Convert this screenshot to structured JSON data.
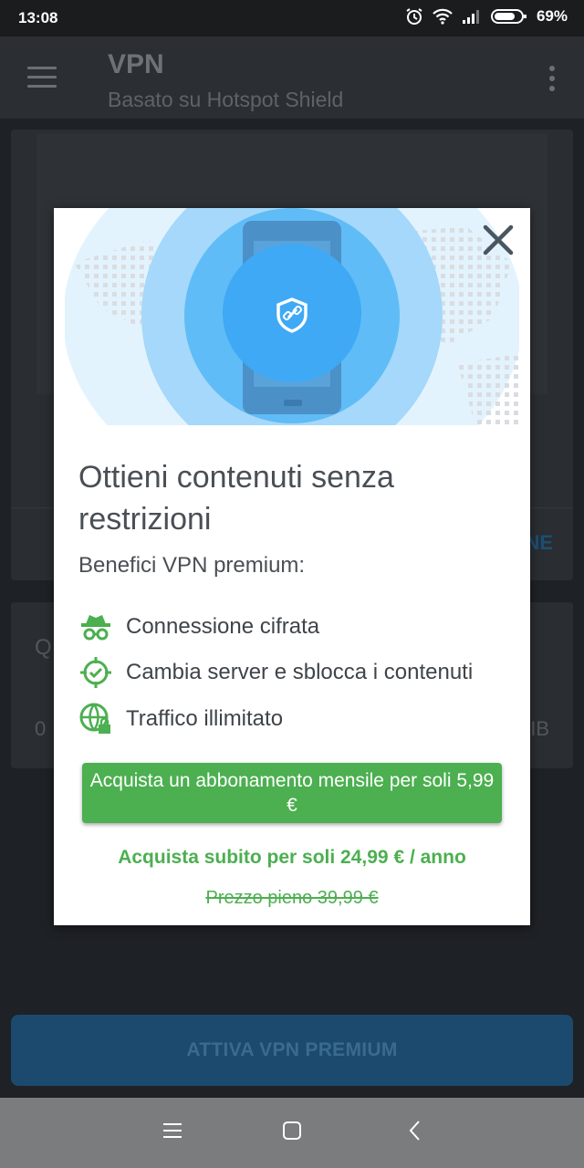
{
  "status_bar": {
    "time": "13:08",
    "battery": "69%",
    "icons": [
      "alarm-icon",
      "wifi-icon",
      "signal-icon",
      "battery-icon"
    ]
  },
  "app_bar": {
    "title": "VPN",
    "subtitle": "Basato su Hotspot Shield"
  },
  "background": {
    "cta_fragment": "NE",
    "q_fragment": "Q",
    "zero_fragment": "0",
    "unit_fragment": "IB"
  },
  "modal": {
    "headline": "Ottieni contenuti senza restrizioni",
    "benefits_title": "Benefici VPN premium:",
    "features": [
      {
        "icon": "incognito-icon",
        "label": "Connessione cifrata"
      },
      {
        "icon": "location-check-icon",
        "label": "Cambia server e sblocca i contenuti"
      },
      {
        "icon": "globe-lock-icon",
        "label": "Traffico illimitato"
      }
    ],
    "monthly_button": "Acquista un abbonamento mensile per soli 5,99 €",
    "yearly_link": "Acquista subito per soli 24,99 € / anno",
    "full_price": "Prezzo pieno 39,99 €"
  },
  "premium_button": "ATTIVA VPN PREMIUM",
  "colors": {
    "accent_green": "#4caf50",
    "blue": "#4fb3f6",
    "app_bar": "#2b2f34"
  }
}
